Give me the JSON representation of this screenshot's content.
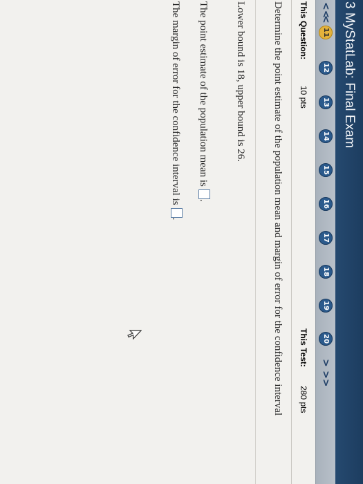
{
  "app": {
    "title": "3 MyStatLab: Final Exam"
  },
  "nav": {
    "prev_all": "<<",
    "prev": "<",
    "next": ">",
    "next_all": ">>",
    "questions": [
      "11",
      "12",
      "13",
      "14",
      "15",
      "16",
      "17",
      "18",
      "19",
      "20"
    ],
    "current": "11"
  },
  "score": {
    "question_label": "This Question:",
    "question_pts": "10 pts",
    "test_label": "This Test:",
    "test_pts": "280 pts"
  },
  "question": {
    "prompt": "Determine the point estimate of the population mean and margin of error for the confidence interval",
    "bounds": "Lower bound is 18, upper bound is 26.",
    "point_estimate_label": "The point estimate of the population mean is",
    "margin_label": "The margin of error for the confidence interval is",
    "period": "."
  },
  "colors": {
    "banner": "#1d3d60",
    "nav_bar": "#b0b8c2",
    "question_button": "#2b5a8c",
    "current_question": "#e3b23c"
  }
}
